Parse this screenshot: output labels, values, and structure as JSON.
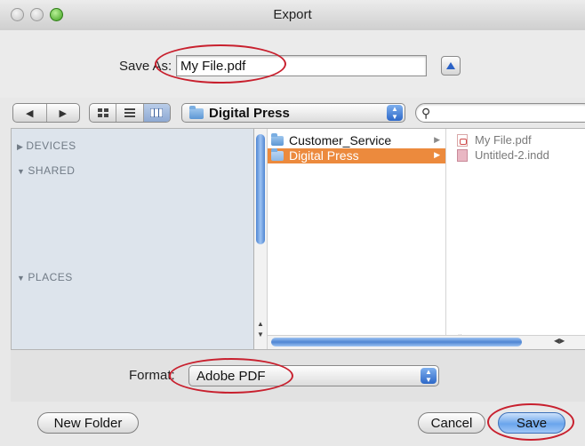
{
  "window": {
    "title": "Export"
  },
  "save_as": {
    "label": "Save As:",
    "value": "My File.pdf"
  },
  "toolbar": {
    "back_label": "◀",
    "forward_label": "▶",
    "location": "Digital Press",
    "search_placeholder": ""
  },
  "sidebar": {
    "sections": [
      {
        "label": "DEVICES",
        "state": "collapsed"
      },
      {
        "label": "SHARED",
        "state": "expanded"
      },
      {
        "label": "PLACES",
        "state": "expanded"
      }
    ]
  },
  "browser": {
    "column1": [
      {
        "label": "Customer_Service",
        "selected": false
      },
      {
        "label": "Digital Press",
        "selected": true
      }
    ],
    "column2": [
      {
        "label": "My File.pdf",
        "icon": "pdf-file-icon"
      },
      {
        "label": "Untitled-2.indd",
        "icon": "indd-file-icon"
      }
    ]
  },
  "format": {
    "label": "Format:",
    "value": "Adobe PDF"
  },
  "buttons": {
    "new_folder": "New Folder",
    "cancel": "Cancel",
    "save": "Save"
  },
  "colors": {
    "selection": "#ec8a3d",
    "accent": "#2d68c8",
    "annotation": "#c8202e",
    "sidebar_bg": "#dde4ec"
  }
}
